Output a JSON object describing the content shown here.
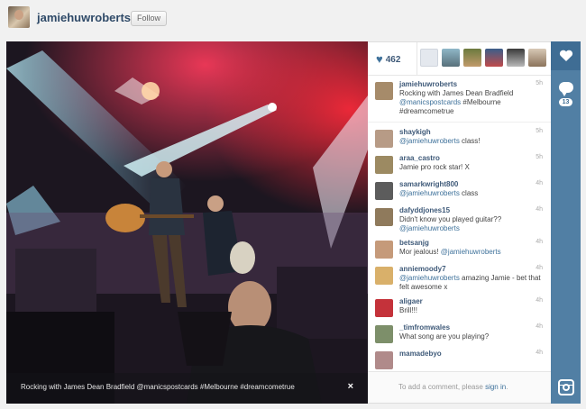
{
  "header": {
    "username": "jamiehuwroberts",
    "follow_label": "Follow"
  },
  "photo": {
    "caption": "Rocking with James Dean Bradfield @manicspostcards #Melbourne #dreamcometrue",
    "close_glyph": "×"
  },
  "likes": {
    "count": "462",
    "heart_glyph": "♥"
  },
  "comments": [
    {
      "user": "jamiehuwroberts",
      "pre": "Rocking with James Dean Bradfield ",
      "mention": "@manicspostcards",
      "post": " #Melbourne #dreamcometrue",
      "time": "5h",
      "color": "#a68b6a"
    },
    {
      "user": "shaykigh",
      "pre": "",
      "mention": "@jamiehuwroberts",
      "post": " class!",
      "time": "5h",
      "color": "#b79b86"
    },
    {
      "user": "araa_castro",
      "pre": "Jamie pro rock star! X",
      "mention": "",
      "post": "",
      "time": "5h",
      "color": "#9c8a62"
    },
    {
      "user": "samarkwright800",
      "pre": "",
      "mention": "@jamiehuwroberts",
      "post": " class",
      "time": "4h",
      "color": "#5c5c5c"
    },
    {
      "user": "dafyddjones15",
      "pre": "Didn't know you played guitar?? ",
      "mention": "@jamiehuwroberts",
      "post": "",
      "time": "4h",
      "color": "#8f7a5c"
    },
    {
      "user": "betsanjg",
      "pre": "Mor jealous! ",
      "mention": "@jamiehuwroberts",
      "post": "",
      "time": "4h",
      "color": "#c59a7a"
    },
    {
      "user": "anniemoody7",
      "pre": "",
      "mention": "@jamiehuwroberts",
      "post": " amazing Jamie - bet that felt awesome x",
      "time": "4h",
      "color": "#d9b06a"
    },
    {
      "user": "aligaer",
      "pre": "Brill!!!",
      "mention": "",
      "post": "",
      "time": "4h",
      "color": "#c4323a"
    },
    {
      "user": "_timfromwales",
      "pre": "What song are you playing?",
      "mention": "",
      "post": "",
      "time": "4h",
      "color": "#7d8f6a"
    },
    {
      "user": "mamadebyo",
      "pre": "",
      "mention": "",
      "post": "",
      "time": "4h",
      "color": "#b08a8a"
    }
  ],
  "add_comment": {
    "prompt": "To add a comment, please ",
    "signin": "sign in",
    "suffix": "."
  },
  "strip": {
    "comment_count": "13"
  },
  "colors": {
    "accent": "#517fa4",
    "link": "#3f729b",
    "username": "#2f4a68"
  },
  "icons": [
    "heart-icon",
    "comment-bubble-icon",
    "instagram-icon",
    "close-icon"
  ]
}
